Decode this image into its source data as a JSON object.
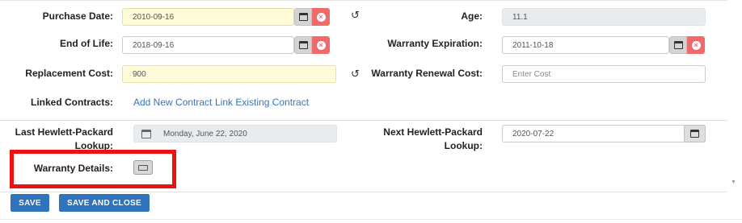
{
  "form": {
    "purchase_date": {
      "label": "Purchase Date:",
      "value": "2010-09-16"
    },
    "age": {
      "label": "Age:",
      "value": "11.1"
    },
    "end_of_life": {
      "label": "End of Life:",
      "value": "2018-09-16"
    },
    "warranty_expiration": {
      "label": "Warranty Expiration:",
      "value": "2011-10-18"
    },
    "replacement_cost": {
      "label": "Replacement Cost:",
      "value": "900"
    },
    "warranty_renewal_cost": {
      "label": "Warranty Renewal Cost:",
      "placeholder": "Enter Cost"
    },
    "linked_contracts": {
      "label": "Linked Contracts:",
      "add_link": "Add New Contract",
      "link_existing": "Link Existing Contract"
    },
    "last_hp_lookup": {
      "label_line1": "Last Hewlett-Packard",
      "label_line2": "Lookup:",
      "value": "Monday, June 22, 2020"
    },
    "next_hp_lookup": {
      "label_line1": "Next Hewlett-Packard",
      "label_line2": "Lookup:",
      "value": "2020-07-22"
    },
    "warranty_details": {
      "label": "Warranty Details:"
    }
  },
  "icons": {
    "calendar": "calendar-icon",
    "clear": "clear-icon",
    "reset": "↺",
    "details": "details-icon"
  },
  "actions": {
    "save": "SAVE",
    "save_and_close": "SAVE AND CLOSE"
  },
  "colors": {
    "primary": "#2f72bd",
    "danger": "#f16a6a",
    "highlight": "#ee1111",
    "readonly_bg": "#e9ecef",
    "edited_bg": "#fdfbd8",
    "link": "#3a74b8"
  }
}
